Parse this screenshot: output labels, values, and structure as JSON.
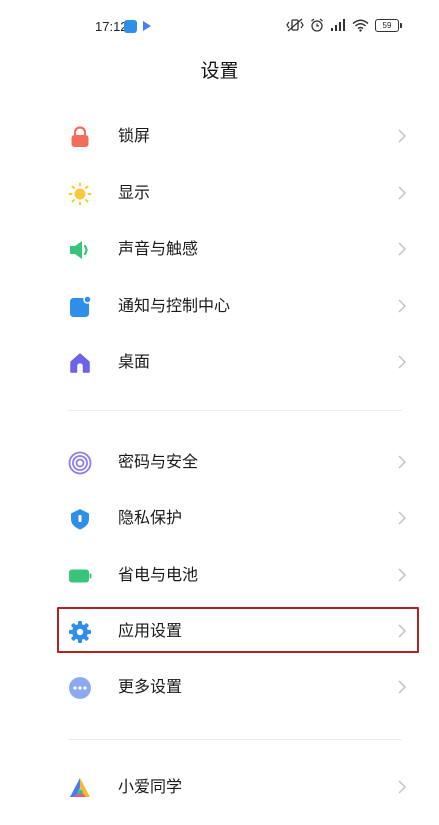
{
  "status_bar": {
    "time": "17:12",
    "battery": "59"
  },
  "header": {
    "title": "设置"
  },
  "groups": [
    {
      "items": [
        {
          "label": "锁屏",
          "icon": "lock-icon",
          "color": "#f26d5b"
        },
        {
          "label": "显示",
          "icon": "sun-icon",
          "color": "#f9c93a"
        },
        {
          "label": "声音与触感",
          "icon": "speaker-icon",
          "color": "#36c57a"
        },
        {
          "label": "通知与控制中心",
          "icon": "notification-icon",
          "color": "#2f8fe8"
        },
        {
          "label": "桌面",
          "icon": "home-icon",
          "color": "#6c63e8"
        }
      ]
    },
    {
      "items": [
        {
          "label": "密码与安全",
          "icon": "fingerprint-icon",
          "color": "#8d7cf0"
        },
        {
          "label": "隐私保护",
          "icon": "privacy-shield-icon",
          "color": "#2f8fe8"
        },
        {
          "label": "省电与电池",
          "icon": "battery-icon",
          "color": "#36c57a"
        },
        {
          "label": "应用设置",
          "icon": "gear-icon",
          "color": "#2f8fe8",
          "highlighted": true
        },
        {
          "label": "更多设置",
          "icon": "more-icon",
          "color": "#8ea9f0"
        }
      ]
    },
    {
      "items": [
        {
          "label": "小爱同学",
          "icon": "xiaoai-icon",
          "color": "#4a7cf0"
        }
      ]
    }
  ]
}
